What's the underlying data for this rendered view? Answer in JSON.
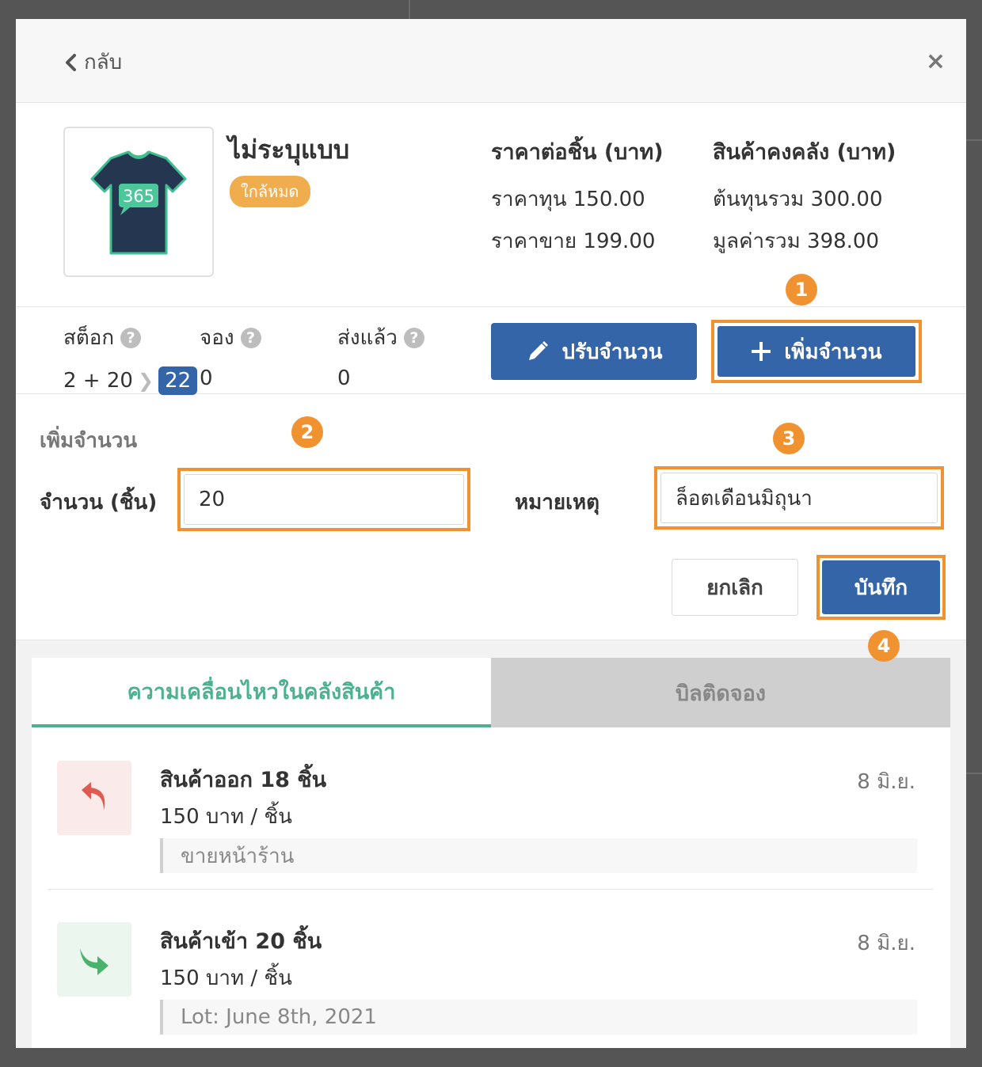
{
  "header": {
    "back_label": "กลับ",
    "close_label": "×"
  },
  "product": {
    "name": "ไม่ระบุแบบ",
    "badge": "ใกล้หมด",
    "image_text": "365",
    "price_title": "ราคาต่อชิ้น (บาท)",
    "cost_price": "ราคาทุน 150.00",
    "sell_price": "ราคาขาย 199.00",
    "stock_title": "สินค้าคงคลัง (บาท)",
    "total_cost": "ต้นทุนรวม 300.00",
    "total_value": "มูลค่ารวม 398.00"
  },
  "stock": {
    "stock_label": "สต็อก",
    "stock_value": "2 + 20",
    "stock_result": "22",
    "reserved_label": "จอง",
    "reserved_value": "0",
    "shipped_label": "ส่งแล้ว",
    "shipped_value": "0",
    "help_glyph": "?"
  },
  "actions": {
    "adjust_label": "ปรับจำนวน",
    "add_label": "เพิ่มจำนวน"
  },
  "form": {
    "title": "เพิ่มจำนวน",
    "qty_label": "จำนวน (ชิ้น)",
    "qty_value": "20",
    "note_label": "หมายเหตุ",
    "note_value": "ล็อตเดือนมิถุนา",
    "cancel_label": "ยกเลิก",
    "save_label": "บันทึก"
  },
  "markers": [
    "1",
    "2",
    "3",
    "4"
  ],
  "tabs": [
    {
      "label": "ความเคลื่อนไหวในคลังสินค้า",
      "active": true
    },
    {
      "label": "บิลติดจอง",
      "active": false
    }
  ],
  "movements": [
    {
      "type": "out",
      "title": "สินค้าออก 18 ชิ้น",
      "price": "150 บาท / ชิ้น",
      "date": "8 มิ.ย.",
      "note": "ขายหน้าร้าน",
      "icon": "arrow-up-left-icon"
    },
    {
      "type": "in",
      "title": "สินค้าเข้า 20 ชิ้น",
      "price": "150 บาท / ชิ้น",
      "date": "8 มิ.ย.",
      "note": "Lot: June 8th, 2021",
      "icon": "arrow-down-right-icon"
    }
  ],
  "colors": {
    "primary": "#3465a8",
    "accent_orange": "#f0922f",
    "badge_orange": "#f0ad4e",
    "green": "#4bb18f",
    "out_red": "#e05a52",
    "in_green": "#49b36b"
  }
}
